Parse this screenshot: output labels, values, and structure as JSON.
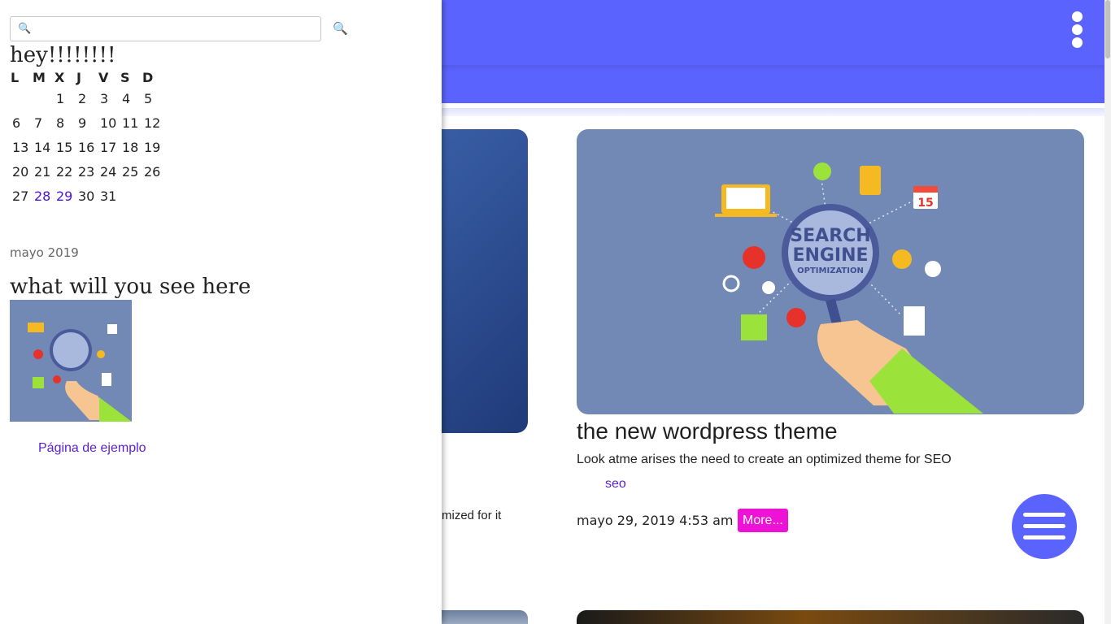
{
  "drawer": {
    "search": {
      "placeholder": "",
      "value": "",
      "icon": "search-icon",
      "button_icon": "search-icon",
      "glyph": "🔍"
    },
    "calendar_title": "hey!!!!!!!!",
    "calendar": {
      "weekdays": [
        "L",
        "M",
        "X",
        "J",
        "V",
        "S",
        "D"
      ],
      "rows": [
        [
          "",
          "",
          "1",
          "2",
          "3",
          "4",
          "5"
        ],
        [
          "6",
          "7",
          "8",
          "9",
          "10",
          "11",
          "12"
        ],
        [
          "13",
          "14",
          "15",
          "16",
          "17",
          "18",
          "19"
        ],
        [
          "20",
          "21",
          "22",
          "23",
          "24",
          "25",
          "26"
        ],
        [
          "27",
          "28",
          "29",
          "30",
          "31",
          "",
          ""
        ]
      ],
      "linked_days": [
        "28",
        "29"
      ],
      "caption": "mayo 2019"
    },
    "image_widget_title": "what will you see here",
    "pages": [
      "Página de ejemplo"
    ]
  },
  "main": {
    "left_post": {
      "excerpt": "mized for it"
    },
    "post": {
      "image_text": [
        "SEARCH",
        "ENGINE",
        "OPTIMIZATION"
      ],
      "calendar_badge": "15",
      "title": "the new wordpress theme",
      "excerpt": "Look atme arises the need to create an optimized theme for SEO",
      "category": "seo",
      "date": "mayo 29, 2019 4:53 am",
      "more_label": "More..."
    }
  },
  "colors": {
    "brand": "#5b63ff",
    "more": "#ee12d6",
    "link": "#5b1fd6",
    "seo_bg": "#7389b5"
  }
}
